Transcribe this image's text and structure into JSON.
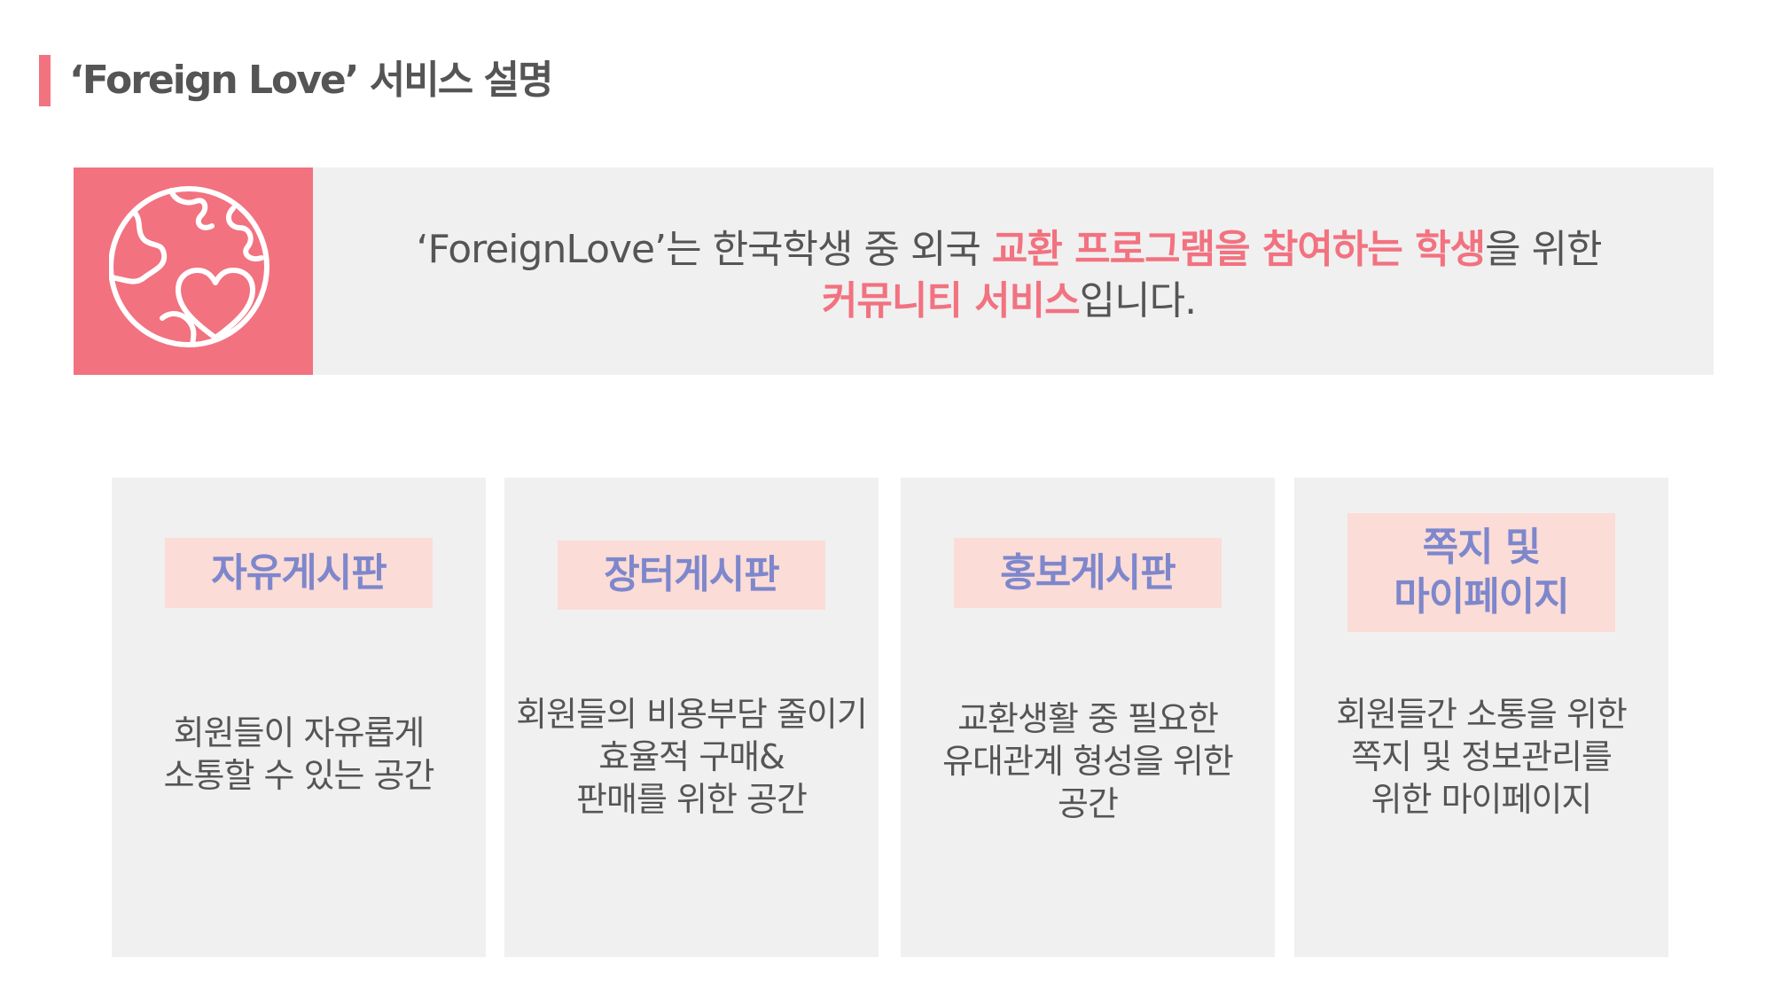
{
  "header": {
    "title": "‘Foreign Love’ 서비스 설명"
  },
  "banner": {
    "icon": "globe-heart-icon",
    "line1_a": "‘ForeignLove’는  한국학생 중 외국 ",
    "line1_hl1": "교환 프로그램을 참여하는 학생",
    "line1_b": "을 위한",
    "line2_hl": "커뮤니티 서비스",
    "line2_b": "입니다."
  },
  "cards": [
    {
      "label": "자유게시판",
      "desc": "회원들이 자유롭게\n소통할 수 있는 공간"
    },
    {
      "label": "장터게시판",
      "desc": "회원들의 비용부담 줄이기\n효율적 구매&\n판매를 위한 공간"
    },
    {
      "label": "홍보게시판",
      "desc": "교환생활 중 필요한\n유대관계 형성을 위한\n공간"
    },
    {
      "label": "쪽지 및\n마이페이지",
      "desc": "회원들간 소통을 위한\n쪽지 및 정보관리를\n위한 마이페이지"
    }
  ],
  "colors": {
    "accent": "#f27280",
    "label_bg": "#fbdcd6",
    "label_text": "#7e87cc",
    "panel_bg": "#f0f0f0",
    "text": "#555555"
  }
}
